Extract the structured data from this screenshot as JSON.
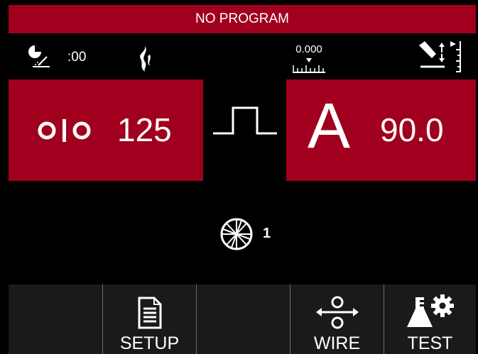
{
  "header": {
    "title": "NO PROGRAM"
  },
  "status_bar": {
    "timer_value": ":00",
    "gauge_value": "0.000",
    "icons": [
      "arc-timer-icon",
      "heat-flame-icon",
      "ruler-gauge-icon",
      "torch-height-icon"
    ]
  },
  "left_panel": {
    "icon": "wire-feed-speed-icon",
    "value": "125"
  },
  "center": {
    "icon": "pulse-waveform-icon"
  },
  "right_panel": {
    "unit": "A",
    "value": "90.0"
  },
  "spool": {
    "icon": "spool-icon",
    "number": "1"
  },
  "bottom_buttons": [
    {
      "label": "",
      "icon": ""
    },
    {
      "label": "SETUP",
      "icon": "document-icon"
    },
    {
      "label": "",
      "icon": ""
    },
    {
      "label": "WIRE",
      "icon": "wire-feed-icon"
    },
    {
      "label": "TEST",
      "icon": "flask-gear-icon"
    }
  ],
  "colors": {
    "accent": "#a0001e",
    "background": "#000000",
    "button_bar": "#1a1a1a"
  }
}
